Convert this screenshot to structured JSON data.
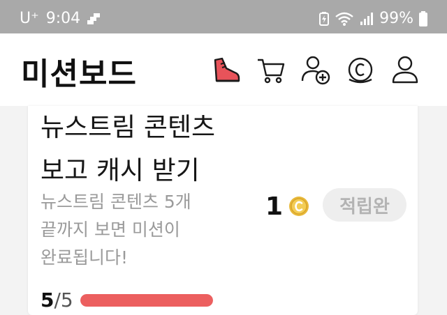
{
  "status_bar": {
    "carrier": "U⁺",
    "time": "9:04",
    "battery": "99%"
  },
  "header": {
    "title": "미션보드",
    "icons": [
      "sneaker-icon",
      "cart-icon",
      "add-friend-icon",
      "coin-history-icon",
      "profile-icon"
    ]
  },
  "mission": {
    "title_line1": "뉴스트림 콘텐츠",
    "title_line2": "보고 캐시 받기",
    "desc_line1": "뉴스트림 콘텐츠 5개",
    "desc_line2": "끝까지 보면 미션이",
    "desc_line3": "완료됩니다!",
    "reward": "1",
    "claim_label": "적립완",
    "progress_current": "5",
    "progress_sep": "/",
    "progress_total": "5",
    "progress_fraction": 1.0
  },
  "colors": {
    "status_bar": "#a9a9a9",
    "accent_red": "#ec5f5f",
    "coin_gold": "#e8b93a"
  }
}
